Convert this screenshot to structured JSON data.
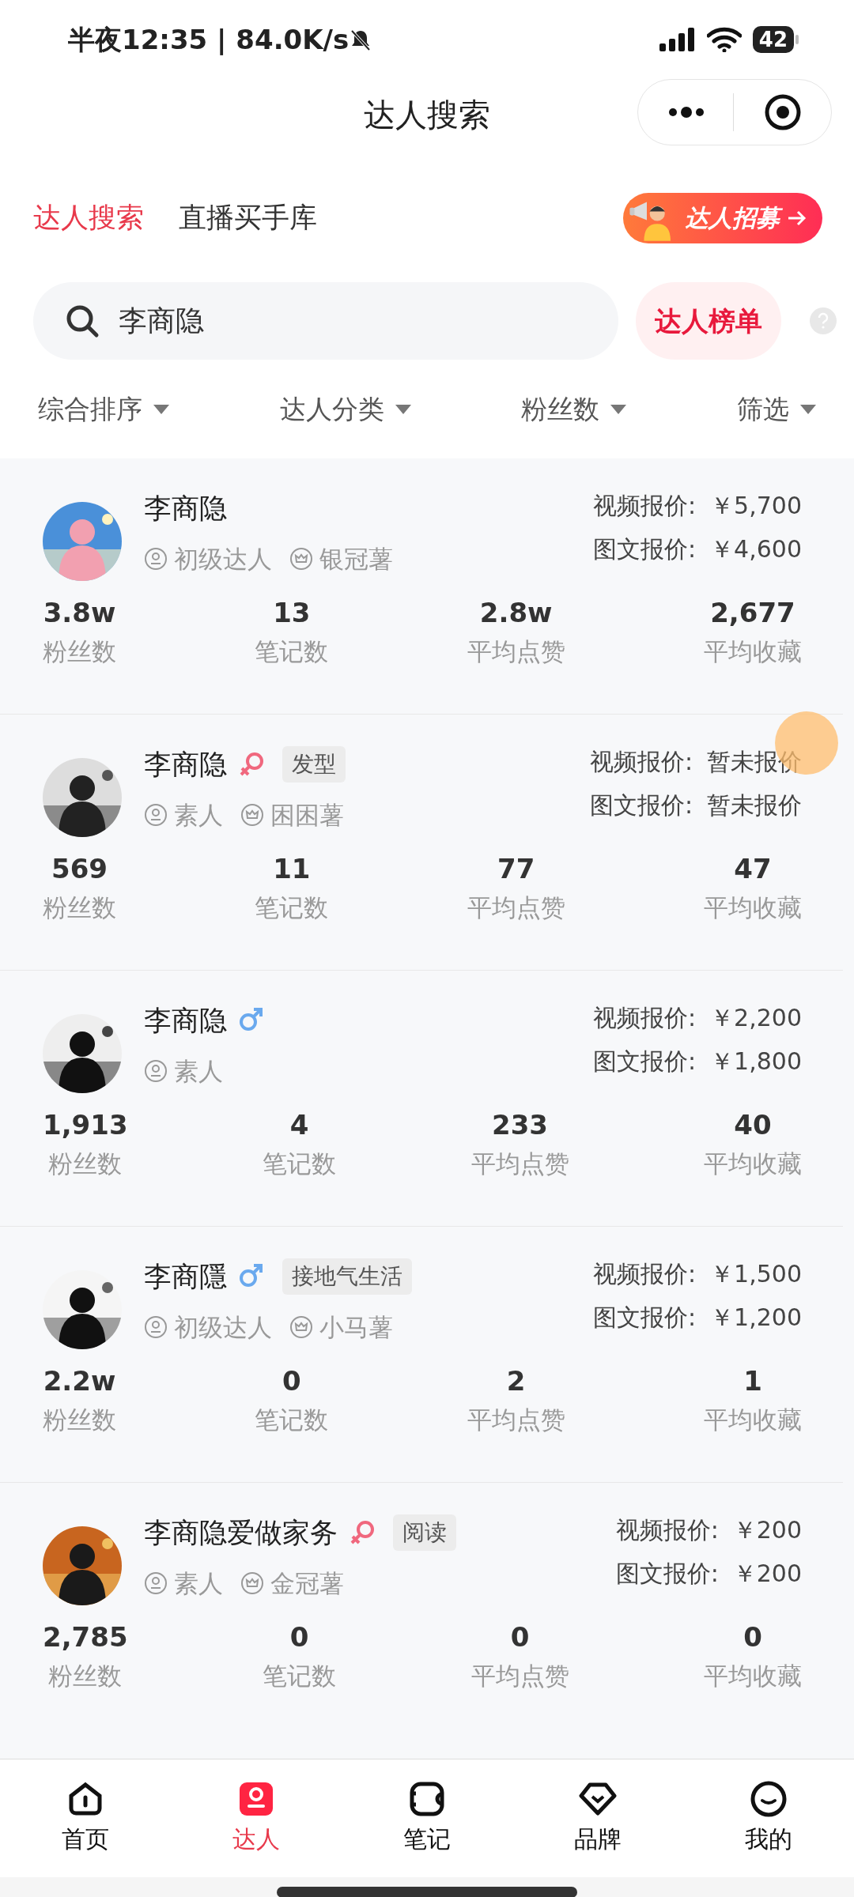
{
  "status_bar": {
    "time": "半夜12:35 | 84.0K/s",
    "battery": "42"
  },
  "title": "达人搜索",
  "tabs": [
    {
      "label": "达人搜索",
      "selected": true
    },
    {
      "label": "直播买手库",
      "selected": false
    }
  ],
  "recruit_banner": {
    "label": "达人招募"
  },
  "search": {
    "value": "李商隐"
  },
  "ranking_button": "达人榜单",
  "filters": [
    {
      "label": "综合排序"
    },
    {
      "label": "达人分类"
    },
    {
      "label": "粉丝数"
    },
    {
      "label": "筛选"
    }
  ],
  "creators": [
    {
      "name": "李商隐",
      "badges": [
        {
          "kind": "level",
          "label": "初级达人"
        },
        {
          "kind": "tier",
          "label": "银冠薯"
        }
      ],
      "video_price_label": "视频报价:",
      "video_price": "￥5,700",
      "image_price_label": "图文报价:",
      "image_price": "￥4,600",
      "stats": [
        {
          "value": "3.8w",
          "label": "粉丝数"
        },
        {
          "value": "13",
          "label": "笔记数"
        },
        {
          "value": "2.8w",
          "label": "平均点赞"
        },
        {
          "value": "2,677",
          "label": "平均收藏"
        }
      ]
    },
    {
      "name": "李商隐",
      "gender_icon": {
        "kind": "female"
      },
      "tag": "发型",
      "badges": [
        {
          "kind": "level",
          "label": "素人"
        },
        {
          "kind": "tier",
          "label": "困困薯"
        }
      ],
      "video_price_label": "视频报价:",
      "video_price": "暂未报价",
      "image_price_label": "图文报价:",
      "image_price": "暂未报价",
      "stats": [
        {
          "value": "569",
          "label": "粉丝数"
        },
        {
          "value": "11",
          "label": "笔记数"
        },
        {
          "value": "77",
          "label": "平均点赞"
        },
        {
          "value": "47",
          "label": "平均收藏"
        }
      ]
    },
    {
      "name": "李商隐",
      "gender_icon": {
        "kind": "male"
      },
      "badges": [
        {
          "kind": "level",
          "label": "素人"
        }
      ],
      "video_price_label": "视频报价:",
      "video_price": "￥2,200",
      "image_price_label": "图文报价:",
      "image_price": "￥1,800",
      "stats": [
        {
          "value": "1,913",
          "label": "粉丝数"
        },
        {
          "value": "4",
          "label": "笔记数"
        },
        {
          "value": "233",
          "label": "平均点赞"
        },
        {
          "value": "40",
          "label": "平均收藏"
        }
      ]
    },
    {
      "name": "李商隱",
      "gender_icon": {
        "kind": "male"
      },
      "tag": "接地气生活",
      "badges": [
        {
          "kind": "level",
          "label": "初级达人"
        },
        {
          "kind": "tier",
          "label": "小马薯"
        }
      ],
      "video_price_label": "视频报价:",
      "video_price": "￥1,500",
      "image_price_label": "图文报价:",
      "image_price": "￥1,200",
      "stats": [
        {
          "value": "2.2w",
          "label": "粉丝数"
        },
        {
          "value": "0",
          "label": "笔记数"
        },
        {
          "value": "2",
          "label": "平均点赞"
        },
        {
          "value": "1",
          "label": "平均收藏"
        }
      ]
    },
    {
      "name": "李商隐爱做家务",
      "gender_icon": {
        "kind": "female"
      },
      "tag": "阅读",
      "badges": [
        {
          "kind": "level",
          "label": "素人"
        },
        {
          "kind": "tier",
          "label": "金冠薯"
        }
      ],
      "video_price_label": "视频报价:",
      "video_price": "￥200",
      "image_price_label": "图文报价:",
      "image_price": "￥200",
      "stats": [
        {
          "value": "2,785",
          "label": "粉丝数"
        },
        {
          "value": "0",
          "label": "笔记数"
        },
        {
          "value": "0",
          "label": "平均点赞"
        },
        {
          "value": "0",
          "label": "平均收藏"
        }
      ]
    }
  ],
  "bottom_nav": [
    {
      "kind": "home",
      "label": "首页",
      "selected": false
    },
    {
      "kind": "creator",
      "label": "达人",
      "selected": true
    },
    {
      "kind": "notes",
      "label": "笔记",
      "selected": false
    },
    {
      "kind": "brand",
      "label": "品牌",
      "selected": false
    },
    {
      "kind": "me",
      "label": "我的",
      "selected": false
    }
  ]
}
